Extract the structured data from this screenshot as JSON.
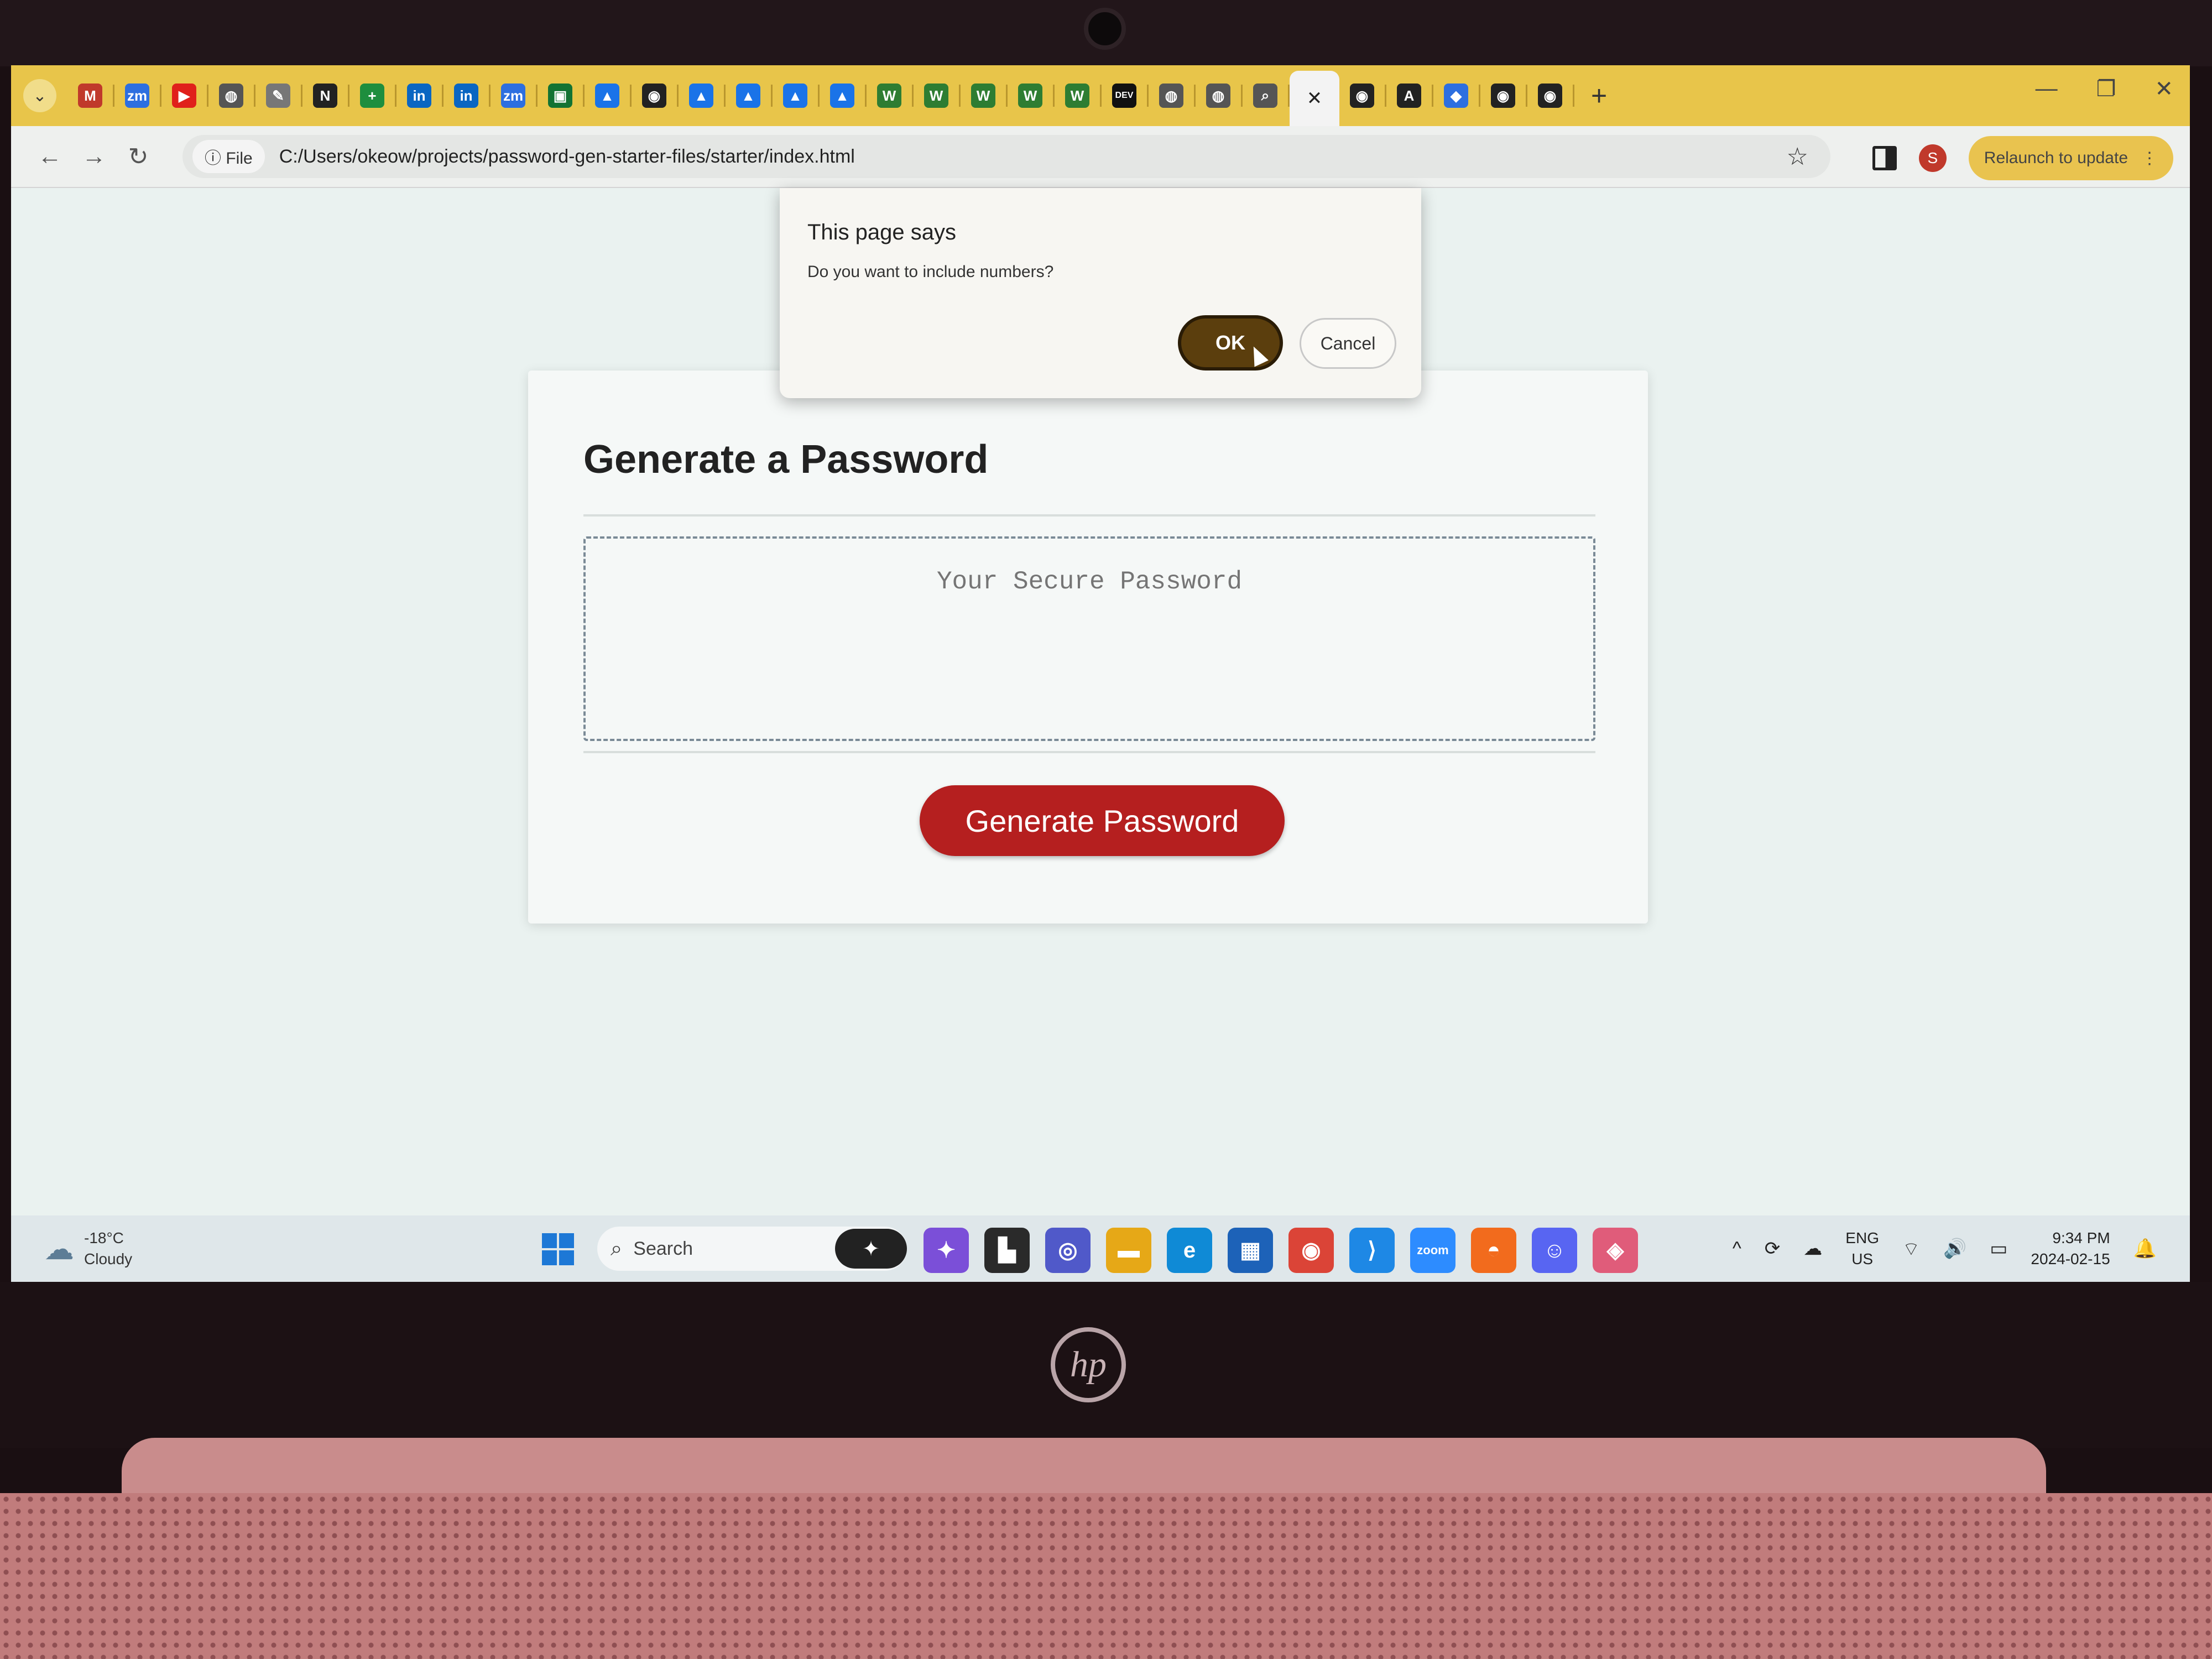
{
  "browser": {
    "tabs": [
      {
        "icon": "gmail-icon",
        "glyph": "M",
        "color": "#c0392b"
      },
      {
        "icon": "zoom-icon",
        "glyph": "zm",
        "color": "#2d6fe0"
      },
      {
        "icon": "youtube-icon",
        "glyph": "▶",
        "color": "#e0201b"
      },
      {
        "icon": "globe-icon",
        "glyph": "◍",
        "color": "#555555"
      },
      {
        "icon": "quill-icon",
        "glyph": "✎",
        "color": "#777777"
      },
      {
        "icon": "notion-icon",
        "glyph": "N",
        "color": "#222222"
      },
      {
        "icon": "sheets-icon",
        "glyph": "+",
        "color": "#1e8e3e"
      },
      {
        "icon": "linkedin-icon",
        "glyph": "in",
        "color": "#0a66c2"
      },
      {
        "icon": "linkedin-icon",
        "glyph": "in",
        "color": "#0a66c2"
      },
      {
        "icon": "zoom-icon",
        "glyph": "zm",
        "color": "#2d6fe0"
      },
      {
        "icon": "classroom-icon",
        "glyph": "▣",
        "color": "#137333"
      },
      {
        "icon": "drive-icon",
        "glyph": "▲",
        "color": "#1a73e8"
      },
      {
        "icon": "github-icon",
        "glyph": "◉",
        "color": "#222222"
      },
      {
        "icon": "drive-icon",
        "glyph": "▲",
        "color": "#1a73e8"
      },
      {
        "icon": "drive-icon",
        "glyph": "▲",
        "color": "#1a73e8"
      },
      {
        "icon": "drive-icon",
        "glyph": "▲",
        "color": "#1a73e8"
      },
      {
        "icon": "drive-icon",
        "glyph": "▲",
        "color": "#1a73e8"
      },
      {
        "icon": "w-icon",
        "glyph": "W",
        "color": "#2e7d32"
      },
      {
        "icon": "w-icon",
        "glyph": "W",
        "color": "#2e7d32"
      },
      {
        "icon": "w-icon",
        "glyph": "W",
        "color": "#2e7d32"
      },
      {
        "icon": "w-icon",
        "glyph": "W",
        "color": "#2e7d32"
      },
      {
        "icon": "w-icon",
        "glyph": "W",
        "color": "#2e7d32"
      },
      {
        "icon": "dev-icon",
        "glyph": "DEV",
        "color": "#111111"
      },
      {
        "icon": "globe-icon",
        "glyph": "◍",
        "color": "#555555"
      },
      {
        "icon": "globe-icon",
        "glyph": "◍",
        "color": "#555555"
      },
      {
        "icon": "search-icon",
        "glyph": "⌕",
        "color": "#555555"
      }
    ],
    "active_tab_close": "✕",
    "tabs_after": [
      {
        "icon": "github-icon",
        "glyph": "◉",
        "color": "#222222"
      },
      {
        "icon": "app-icon",
        "glyph": "A",
        "color": "#222222"
      },
      {
        "icon": "puzzle-icon",
        "glyph": "◆",
        "color": "#2d6fe0"
      },
      {
        "icon": "github-icon",
        "glyph": "◉",
        "color": "#222222"
      },
      {
        "icon": "github-icon",
        "glyph": "◉",
        "color": "#222222"
      }
    ],
    "new_tab": "+",
    "window_controls": {
      "minimize": "—",
      "restore": "❐",
      "close": "✕"
    },
    "nav": {
      "back": "←",
      "forward": "→",
      "reload": "↻"
    },
    "address": {
      "chip_label": "File",
      "url": "C:/Users/okeow/projects/password-gen-starter-files/starter/index.html"
    },
    "star": "☆",
    "profile_initial": "S",
    "relaunch_label": "Relaunch to update",
    "menu_glyph": "⋮"
  },
  "dialog": {
    "title": "This page says",
    "message": "Do you want to include numbers?",
    "ok_label": "OK",
    "cancel_label": "Cancel"
  },
  "page": {
    "heading": "Generate a Password",
    "password_placeholder": "Your Secure Password",
    "generate_label": "Generate Password"
  },
  "taskbar": {
    "weather_temp": "-18°C",
    "weather_desc": "Cloudy",
    "search_label": "Search",
    "apps": [
      {
        "icon": "copilot-icon",
        "glyph": "✦",
        "color": "#7b4fd8"
      },
      {
        "icon": "terminal-icon",
        "glyph": "▙",
        "color": "#2a2a2a"
      },
      {
        "icon": "teams-icon",
        "glyph": "◎",
        "color": "#5059c9"
      },
      {
        "icon": "folder-icon",
        "glyph": "▬",
        "color": "#e6a817"
      },
      {
        "icon": "edge-icon",
        "glyph": "e",
        "color": "#0f8ad6"
      },
      {
        "icon": "store-icon",
        "glyph": "▦",
        "color": "#1d62b8"
      },
      {
        "icon": "chrome-icon",
        "glyph": "◉",
        "color": "#db4437"
      },
      {
        "icon": "vscode-icon",
        "glyph": "⟩",
        "color": "#1e88e5"
      },
      {
        "icon": "zoom-icon",
        "glyph": "zoom",
        "color": "#2d8cff"
      },
      {
        "icon": "shopping-bag-icon",
        "glyph": "◓",
        "color": "#f26b1d"
      },
      {
        "icon": "discord-icon",
        "glyph": "☺",
        "color": "#5865f2"
      },
      {
        "icon": "jetbrains-icon",
        "glyph": "◈",
        "color": "#e05c7a"
      }
    ],
    "tray_chevron": "^",
    "language_top": "ENG",
    "language_bottom": "US",
    "time": "9:34 PM",
    "date": "2024-02-15",
    "notification_glyph": "🔔"
  },
  "device": {
    "logo": "hp"
  }
}
